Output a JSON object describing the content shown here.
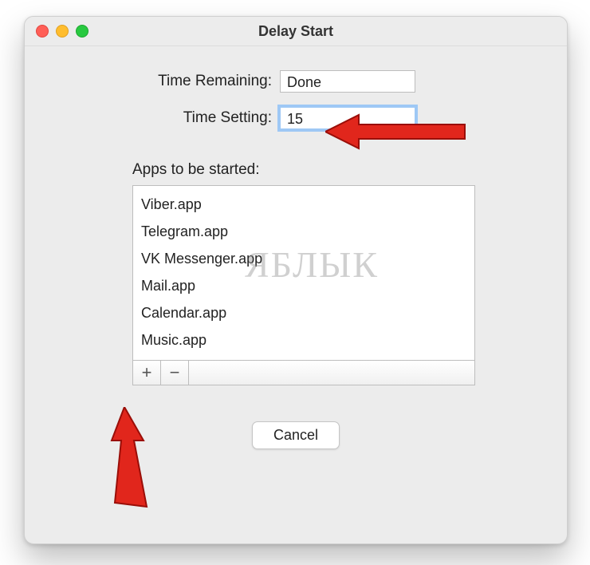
{
  "window": {
    "title": "Delay Start"
  },
  "form": {
    "time_remaining_label": "Time Remaining:",
    "time_remaining_value": "Done",
    "time_setting_label": "Time Setting:",
    "time_setting_value": "15"
  },
  "apps": {
    "label": "Apps to be started:",
    "items": [
      "Viber.app",
      "Telegram.app",
      "VK Messenger.app",
      "Mail.app",
      "Calendar.app",
      "Music.app"
    ]
  },
  "buttons": {
    "add": "+",
    "remove": "−",
    "cancel": "Cancel"
  },
  "watermark": "ЯБЛЫК",
  "annotation_color": "#e1261c"
}
